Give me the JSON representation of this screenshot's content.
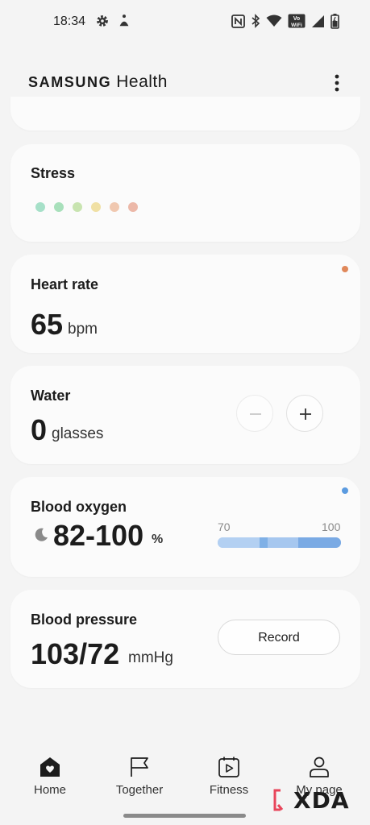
{
  "status_bar": {
    "time": "18:34",
    "icons": [
      "settings-icon",
      "accessibility-icon",
      "nfc-icon",
      "bluetooth-icon",
      "wifi-icon",
      "vowifi-icon",
      "cell-signal-icon",
      "battery-icon"
    ],
    "vowifi_top": "Vo",
    "vowifi_bottom": "WiFi"
  },
  "app_bar": {
    "brand": "SAMSUNG",
    "product": "Health",
    "menu_icon": "more-vert-icon"
  },
  "cards": {
    "stress": {
      "title": "Stress",
      "dot_colors": [
        "#a6e0c8",
        "#a8e0bb",
        "#c8e4b0",
        "#f0e0a4",
        "#f0c8b0",
        "#ecb8a8"
      ]
    },
    "heart_rate": {
      "title": "Heart rate",
      "value": "65",
      "unit": "bpm",
      "indicator_color": "#e0885a"
    },
    "water": {
      "title": "Water",
      "value": "0",
      "unit": "glasses",
      "decrement_icon": "minus-icon",
      "increment_icon": "plus-icon"
    },
    "blood_oxygen": {
      "title": "Blood oxygen",
      "value": "82-100",
      "unit": "%",
      "range_min": "70",
      "range_max": "100",
      "sleep_icon": "moon-icon",
      "indicator_color": "#5b9be0"
    },
    "blood_pressure": {
      "title": "Blood pressure",
      "value": "103/72",
      "unit": "mmHg",
      "record_label": "Record"
    }
  },
  "bottom_nav": [
    {
      "label": "Home",
      "icon": "home-heart-icon",
      "active": true
    },
    {
      "label": "Together",
      "icon": "flag-icon",
      "active": false
    },
    {
      "label": "Fitness",
      "icon": "calendar-play-icon",
      "active": false
    },
    {
      "label": "My page",
      "icon": "person-icon",
      "active": false
    }
  ],
  "watermark": {
    "text": "XDA"
  },
  "colors": {
    "background": "#f4f4f4",
    "card": "#fbfbfb",
    "text": "#1c1c1c",
    "heart_indicator": "#e0885a",
    "oxygen_indicator": "#5b9be0"
  }
}
